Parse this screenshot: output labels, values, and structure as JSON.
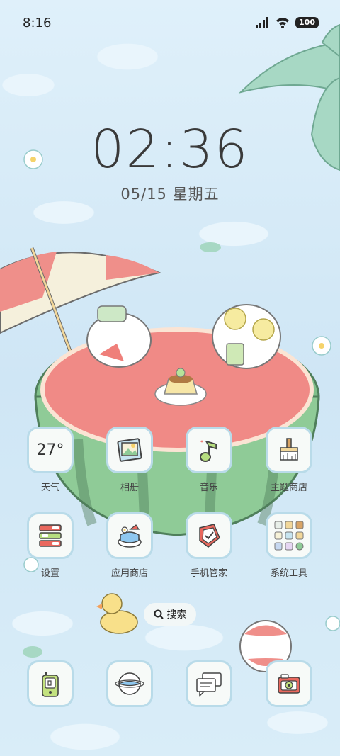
{
  "status_bar": {
    "time": "8:16",
    "battery": "100",
    "icons": [
      "signal-icon",
      "wifi-icon",
      "battery-icon"
    ]
  },
  "lock_clock": {
    "time": "02:36",
    "date": "05/15 星期五"
  },
  "apps_row1": [
    {
      "label": "天气",
      "icon": "weather-widget",
      "value": "27°"
    },
    {
      "label": "相册",
      "icon": "gallery-icon"
    },
    {
      "label": "音乐",
      "icon": "music-icon"
    },
    {
      "label": "主题商店",
      "icon": "theme-store-icon"
    }
  ],
  "apps_row2": [
    {
      "label": "设置",
      "icon": "settings-icon"
    },
    {
      "label": "应用商店",
      "icon": "app-store-icon"
    },
    {
      "label": "手机管家",
      "icon": "security-icon"
    },
    {
      "label": "系统工具",
      "icon": "system-tools-folder"
    }
  ],
  "search": {
    "label": "搜索"
  },
  "dock": [
    {
      "icon": "phone-icon"
    },
    {
      "icon": "browser-icon"
    },
    {
      "icon": "messages-icon"
    },
    {
      "icon": "camera-icon"
    }
  ],
  "colors": {
    "tile_border": "#b9dbe9",
    "tile_bg": "#f7faf8",
    "watermelon_flesh": "#f08a86",
    "watermelon_rind": "#7fbf8a",
    "water": "#d7ebf7"
  }
}
